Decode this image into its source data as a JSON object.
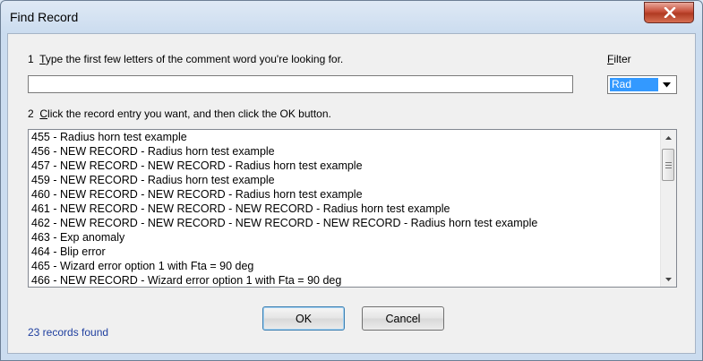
{
  "window": {
    "title": "Find Record"
  },
  "step1": {
    "number": "1",
    "underline": "T",
    "rest": "ype the first few letters of the comment word you're looking for."
  },
  "filter": {
    "underline": "F",
    "rest": "ilter",
    "selected": "Rad"
  },
  "search": {
    "value": "",
    "placeholder": ""
  },
  "step2": {
    "number": "2",
    "underline": "C",
    "rest": "lick the record entry you want, and then click the OK button."
  },
  "records": [
    "455 - Radius horn test example",
    "456 - NEW RECORD - Radius horn test example",
    "457 - NEW RECORD - NEW RECORD - Radius horn test example",
    "459 - NEW RECORD - Radius horn test example",
    "460 - NEW RECORD - NEW RECORD - Radius horn test example",
    "461 - NEW RECORD - NEW RECORD - NEW RECORD - Radius horn test example",
    "462 - NEW RECORD - NEW RECORD - NEW RECORD - NEW RECORD - Radius horn test example",
    "463 - Exp anomaly",
    "464 - Blip error",
    "465 - Wizard error option 1 with Fta = 90 deg",
    "466 - NEW RECORD - Wizard error option 1 with Fta = 90 deg"
  ],
  "buttons": {
    "ok": "OK",
    "cancel": "Cancel"
  },
  "status": "23 records found",
  "colors": {
    "selection": "#3399ff",
    "status_text": "#1f3f9f",
    "close_button": "#c7503a"
  },
  "icons": {
    "close": "close-icon",
    "dropdown": "chevron-down-icon",
    "scroll_up": "arrow-up-icon",
    "scroll_down": "arrow-down-icon"
  }
}
